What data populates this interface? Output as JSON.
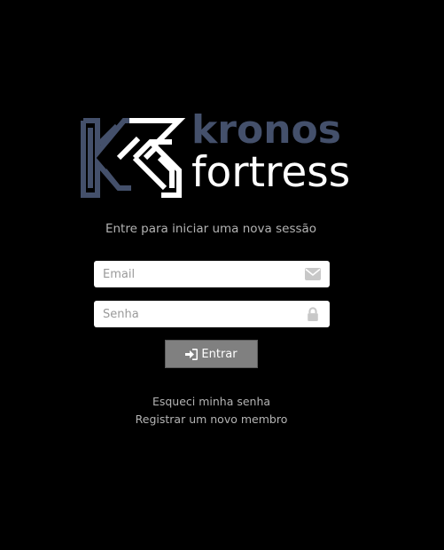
{
  "brand": {
    "line1": "kronos",
    "line2": "fortress",
    "logo_icon": "k-maze-logo-icon",
    "colors": {
      "dark_blue": "#44506b",
      "white": "#ffffff"
    }
  },
  "subtitle": "Entre para iniciar uma nova sessão",
  "form": {
    "email": {
      "placeholder": "Email",
      "value": "",
      "icon": "envelope-icon"
    },
    "senha": {
      "placeholder": "Senha",
      "value": "",
      "icon": "lock-icon"
    },
    "submit": {
      "label": "Entrar",
      "icon": "sign-in-icon"
    }
  },
  "links": {
    "forgot": "Esqueci minha senha",
    "register": "Registrar um novo membro"
  },
  "colors": {
    "background": "#000000",
    "button": "#808080",
    "muted_text": "#b3b3b3"
  }
}
